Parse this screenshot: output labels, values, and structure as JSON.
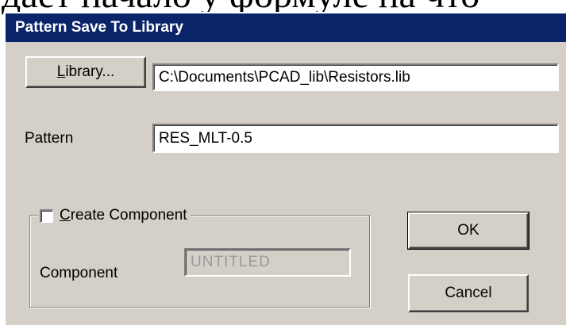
{
  "background_text": "дает начало у формуле на что",
  "dialog": {
    "title": "Pattern Save To Library",
    "library_button": {
      "mnemonic": "L",
      "rest": "ibrary..."
    },
    "library_path": "C:\\Documents\\PCAD_lib\\Resistors.lib",
    "pattern_label": "Pattern",
    "pattern_value": "RES_MLT-0.5",
    "create_component": {
      "mnemonic": "C",
      "rest": "reate Component",
      "checked": false
    },
    "component_label": "Component",
    "component_value": "UNTITLED",
    "ok_label": "OK",
    "cancel_label": "Cancel"
  },
  "colors": {
    "title_bar": "#0a246a",
    "dialog_face": "#d4d0c8",
    "field_bg": "#ffffff",
    "disabled_text": "#9a9a9a"
  }
}
